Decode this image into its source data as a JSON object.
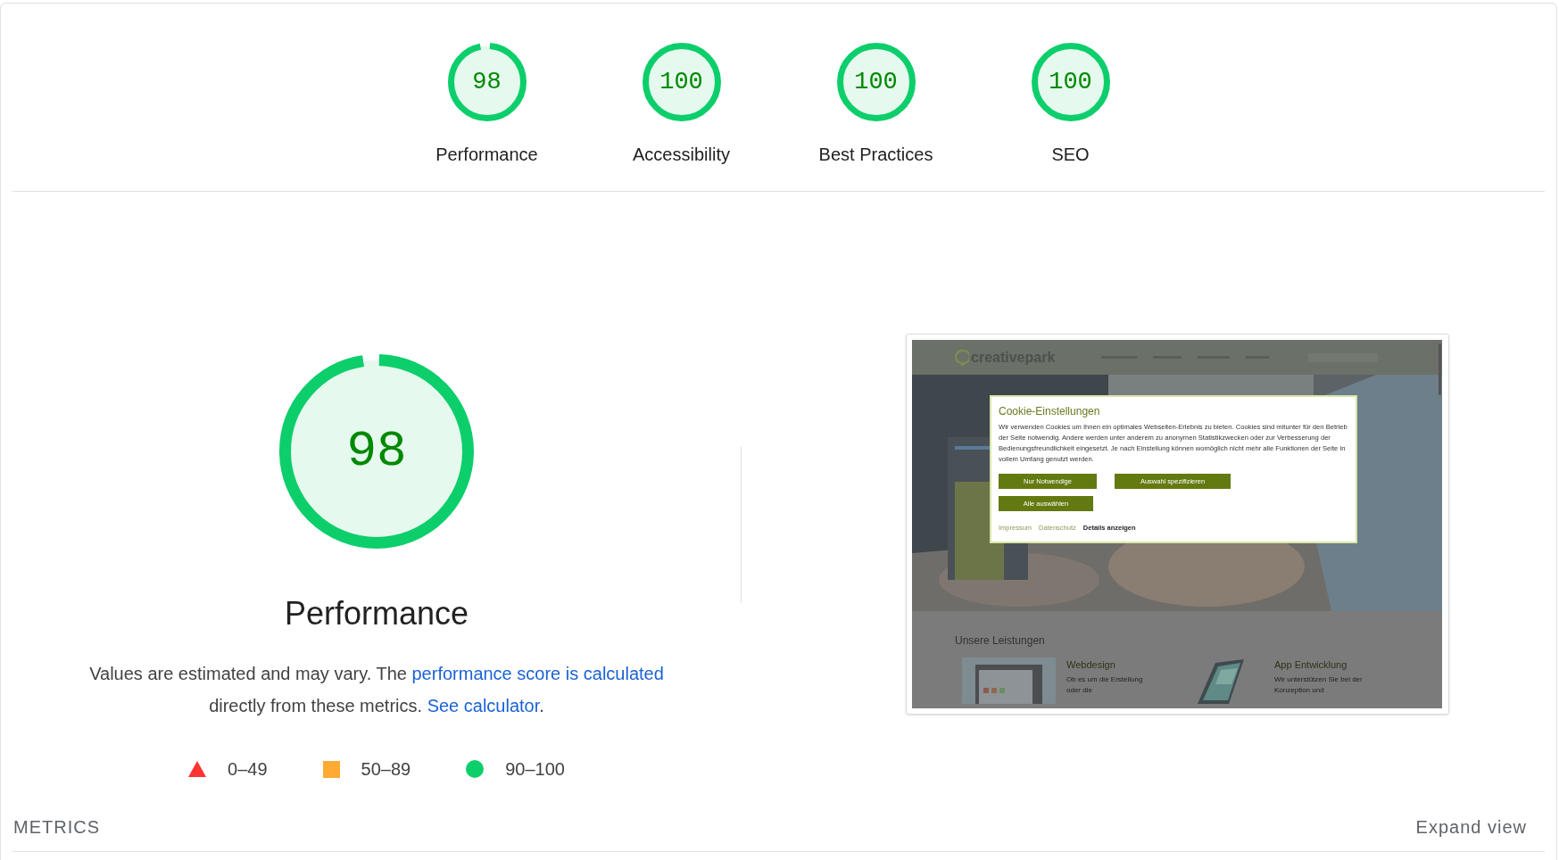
{
  "categories": [
    {
      "label": "Performance",
      "score": "98",
      "level": 0.98
    },
    {
      "label": "Accessibility",
      "score": "100",
      "level": 1
    },
    {
      "label": "Best Practices",
      "score": "100",
      "level": 1
    },
    {
      "label": "SEO",
      "score": "100",
      "level": 1
    }
  ],
  "main": {
    "score": "98",
    "level": 0.98,
    "title": "Performance",
    "description": {
      "before": "Values are estimated and may vary. The ",
      "link1": "performance score is calculated",
      "middle": " directly from these metrics. ",
      "link2": "See calculator",
      "after": "."
    }
  },
  "legend": [
    {
      "kind": "fail",
      "label": "0–49",
      "color": "#ff3333"
    },
    {
      "kind": "average",
      "label": "50–89",
      "color": "#ffaa33"
    },
    {
      "kind": "pass",
      "label": "90–100",
      "color": "#0cce6b"
    }
  ],
  "screenshot": {
    "logo": "creativepark",
    "dialog": {
      "title": "Cookie-Einstellungen",
      "body": "Wir verwenden Cookies um Ihnen ein optimales Webseiten-Erlebnis zu bieten. Cookies sind mitunter für den Betrieb der Seite notwendig. Andere werden unter anderem zu anonymen Statistikzwecken oder zur Verbesserung der Bedienungsfreundlichkeit eingesetzt. Je nach Einstellung können womöglich nicht mehr alle Funktionen der Seite in vollem Umfang genutzt werden.",
      "buttons": [
        "Nur Notwendige",
        "Auswahl spezifizieren",
        "Alle auswählen"
      ],
      "links": [
        {
          "kind": "link",
          "label": "Impressum"
        },
        {
          "kind": "link",
          "label": "Datenschutz"
        },
        {
          "kind": "action",
          "label": "Details anzeigen"
        }
      ]
    },
    "section_title": "Unsere Leistungen",
    "services": [
      {
        "title": "Webdesign",
        "text": "Ob es um die Erstellung oder die"
      },
      {
        "title": "App Entwicklung",
        "text": "Wir unterstützen Sie bei der Konzeption und"
      }
    ]
  },
  "metrics": {
    "heading": "METRICS",
    "expand": "Expand view"
  }
}
